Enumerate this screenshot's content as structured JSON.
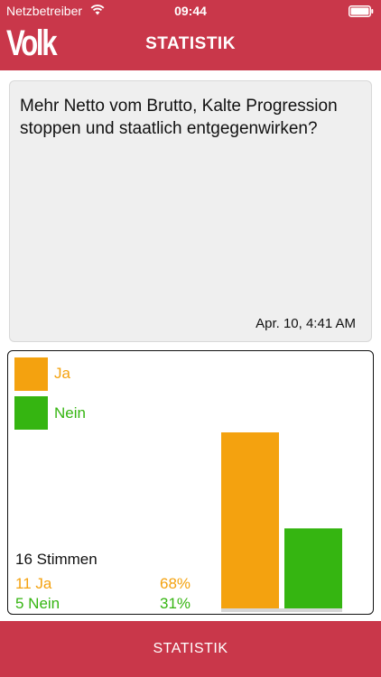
{
  "status_bar": {
    "carrier": "Netzbetreiber",
    "time": "09:44",
    "wifi_icon": "wifi-icon",
    "battery_icon": "battery-icon"
  },
  "nav": {
    "logo": "Volk",
    "title": "STATISTIK"
  },
  "question": {
    "text": "Mehr Netto vom Brutto, Kalte Progression stoppen und staatlich entgegenwirken?",
    "date": "Apr. 10, 4:41 AM"
  },
  "stats": {
    "total": "16 Stimmen",
    "options": [
      {
        "legend": "Ja",
        "count_label": "11 Ja",
        "percent_label": "68%",
        "value": 11,
        "color": "#f4a20f"
      },
      {
        "legend": "Nein",
        "count_label": "5 Nein",
        "percent_label": "31%",
        "value": 5,
        "color": "#35b511"
      }
    ]
  },
  "chart_data": {
    "type": "bar",
    "categories": [
      "Ja",
      "Nein"
    ],
    "values": [
      11,
      5
    ],
    "colors": [
      "#f4a20f",
      "#35b511"
    ],
    "ylim": [
      0,
      11
    ]
  },
  "bottom": {
    "button_label": "STATISTIK"
  },
  "colors": {
    "brand": "#c9374a",
    "yes": "#f4a20f",
    "no": "#35b511"
  }
}
